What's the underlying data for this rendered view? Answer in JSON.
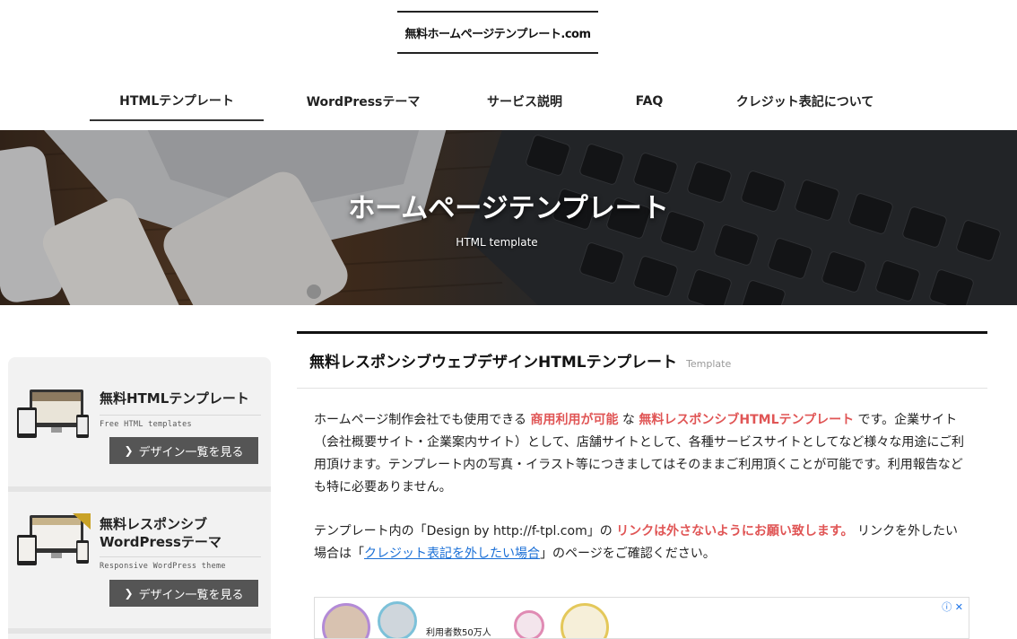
{
  "header": {
    "logo_text": "無料ホームページテンプレート.com"
  },
  "nav": [
    {
      "label": "HTMLテンプレート",
      "active": true
    },
    {
      "label": "WordPressテーマ",
      "active": false
    },
    {
      "label": "サービス説明",
      "active": false
    },
    {
      "label": "FAQ",
      "active": false
    },
    {
      "label": "クレジット表記について",
      "active": false
    }
  ],
  "hero": {
    "title": "ホームページテンプレート",
    "subtitle": "HTML template"
  },
  "sidebar": {
    "cards": [
      {
        "title": "無料HTMLテンプレート",
        "subtitle": "Free HTML templates",
        "button": "デザイン一覧を見る"
      },
      {
        "title_line1": "無料レスポンシブ",
        "title_line2": "WordPressテーマ",
        "subtitle": "Responsive WordPress theme",
        "button": "デザイン一覧を見る"
      }
    ]
  },
  "main": {
    "title": "無料レスポンシブウェブデザインHTMLテンプレート",
    "tag": "Template",
    "p1": {
      "t1": "ホームページ制作会社でも使用できる ",
      "r1": "商用利用が可能",
      "t2": " な ",
      "r2": "無料レスポンシブHTMLテンプレート",
      "t3": " です。企業サイト（会社概要サイト・企業案内サイト）として、店舗サイトとして、各種サービスサイトとしてなど様々な用途にご利用頂けます。テンプレート内の写真・イラスト等につきましてはそのままご利用頂くことが可能です。利用報告なども特に必要ありません。"
    },
    "p2": {
      "t1": "テンプレート内の「Design by http://f-tpl.com」の ",
      "r1": "リンクは外さないようにお願い致します。",
      "t2": " リンクを外したい場合は「",
      "link": "クレジット表記を外したい場合",
      "t3": "」のページをご確認ください。"
    }
  },
  "ad": {
    "text": "利用者数50万人",
    "info_icon": "ⓘ",
    "close_icon": "✕"
  },
  "colors": {
    "accent_red": "#e05555",
    "link_blue": "#1a6fd6",
    "button_gray": "#555555"
  }
}
